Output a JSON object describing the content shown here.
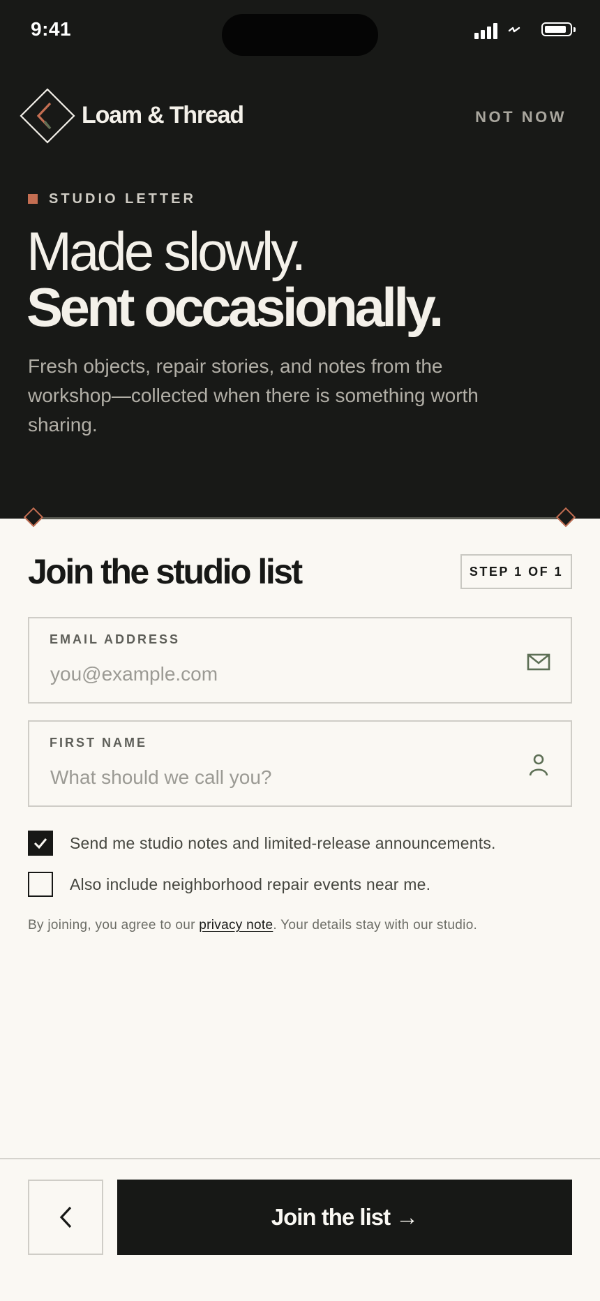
{
  "status_bar": {
    "time": "9:41",
    "icons": [
      "signal-icon",
      "wifi-icon",
      "battery-icon"
    ]
  },
  "header": {
    "brand_name": "Loam & Thread",
    "logo_icon": "diamond-chevron-logo",
    "not_now_label": "NOT NOW"
  },
  "hero": {
    "eyebrow": "STUDIO LETTER",
    "headline_line1": "Made slowly.",
    "headline_line2": "Sent occasionally.",
    "subtitle": "Fresh objects, repair stories, and notes from the workshop—collected when there is something worth sharing."
  },
  "form": {
    "title": "Join the studio list",
    "step": "STEP 1 OF 1",
    "email": {
      "label": "EMAIL ADDRESS",
      "placeholder": "you@example.com",
      "value": "",
      "icon": "mail-icon"
    },
    "first_name": {
      "label": "FIRST NAME",
      "placeholder": "What should we call you?",
      "value": "",
      "icon": "person-icon"
    },
    "checkboxes": [
      {
        "label": "Send me studio notes and limited-release announcements.",
        "checked": true
      },
      {
        "label": "Also include neighborhood repair events near me.",
        "checked": false
      }
    ],
    "legal_prefix": "By joining, you agree to our ",
    "legal_link": "privacy note",
    "legal_suffix": ". Your details stay with our studio."
  },
  "footer": {
    "back_icon": "chevron-left-icon",
    "submit_label": "Join the list →"
  },
  "colors": {
    "hero_background": "#181917",
    "page_background": "#faf8f3",
    "accent": "#c46e52",
    "icon_green": "#5d6f55",
    "ink": "#171816"
  }
}
